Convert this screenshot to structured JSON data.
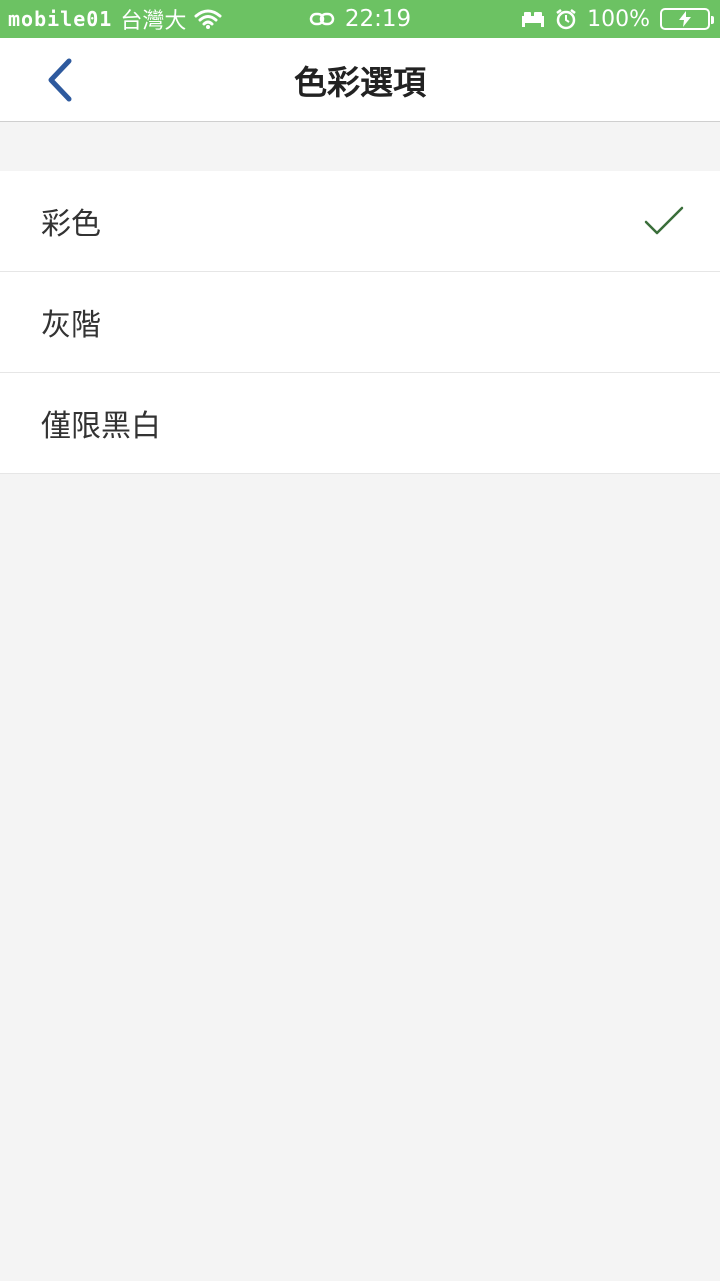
{
  "status_bar": {
    "watermark": "mobile01",
    "carrier": "台灣大",
    "time": "22:19",
    "battery_percent": "100%",
    "background_color": "#6cc263"
  },
  "nav": {
    "title": "色彩選項",
    "back_icon": "chevron-left-icon",
    "back_icon_color": "#2e5a9e"
  },
  "options": [
    {
      "label": "彩色",
      "selected": true
    },
    {
      "label": "灰階",
      "selected": false
    },
    {
      "label": "僅限黑白",
      "selected": false
    }
  ],
  "colors": {
    "check": "#3a6e3a",
    "background": "#f4f4f4"
  }
}
